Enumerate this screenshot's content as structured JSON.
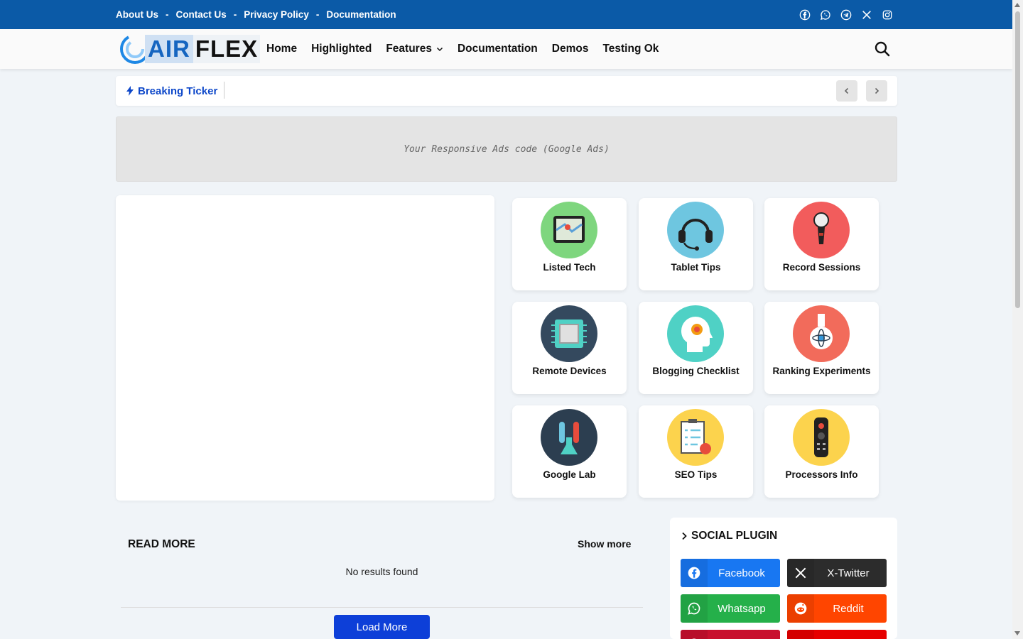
{
  "topbar": {
    "links": [
      "About Us",
      "Contact Us",
      "Privacy Policy",
      "Documentation"
    ],
    "separator": "-",
    "social_icons": [
      "facebook-icon",
      "whatsapp-icon",
      "telegram-icon",
      "x-twitter-icon",
      "instagram-icon"
    ],
    "bg_color": "#0b5aa7"
  },
  "header": {
    "logo_air": "AIR",
    "logo_flex": "FLEX",
    "nav": [
      "Home",
      "Highlighted",
      "Features",
      "Documentation",
      "Demos",
      "Testing Ok"
    ],
    "search_icon": "search-icon"
  },
  "ticker": {
    "label": "Breaking Ticker",
    "prev_icon": "chevron-left-icon",
    "next_icon": "chevron-right-icon"
  },
  "ads": {
    "text": "Your Responsive Ads code (Google Ads)"
  },
  "categories": [
    {
      "name": "Listed Tech",
      "icon": "tablet-map-icon",
      "color": "#7ed67e"
    },
    {
      "name": "Tablet Tips",
      "icon": "headset-icon",
      "color": "#6ec6e0"
    },
    {
      "name": "Record Sessions",
      "icon": "microphone-icon",
      "color": "#f25c5c"
    },
    {
      "name": "Remote Devices",
      "icon": "chip-icon",
      "color": "#34495e"
    },
    {
      "name": "Blogging Checklist",
      "icon": "head-idea-icon",
      "color": "#4fd1c5"
    },
    {
      "name": "Ranking Experiments",
      "icon": "flask-icon",
      "color": "#f26b5b"
    },
    {
      "name": "Google Lab",
      "icon": "lab-tubes-icon",
      "color": "#2c3e50"
    },
    {
      "name": "SEO Tips",
      "icon": "clipboard-icon",
      "color": "#fcd34d"
    },
    {
      "name": "Processors Info",
      "icon": "remote-control-icon",
      "color": "#fcd34d"
    }
  ],
  "read_more": {
    "title": "READ MORE",
    "show_more": "Show more",
    "empty": "No results found",
    "load_more": "Load More"
  },
  "social_plugin": {
    "title": "SOCIAL PLUGIN",
    "buttons": [
      {
        "label": "Facebook",
        "color": "#1877f2"
      },
      {
        "label": "X-Twitter",
        "color": "#2c2c2c"
      },
      {
        "label": "Whatsapp",
        "color": "#25b04a"
      },
      {
        "label": "Reddit",
        "color": "#ff4500"
      },
      {
        "label": "",
        "color": "#c8102e"
      },
      {
        "label": "",
        "color": "#e60000"
      }
    ]
  }
}
